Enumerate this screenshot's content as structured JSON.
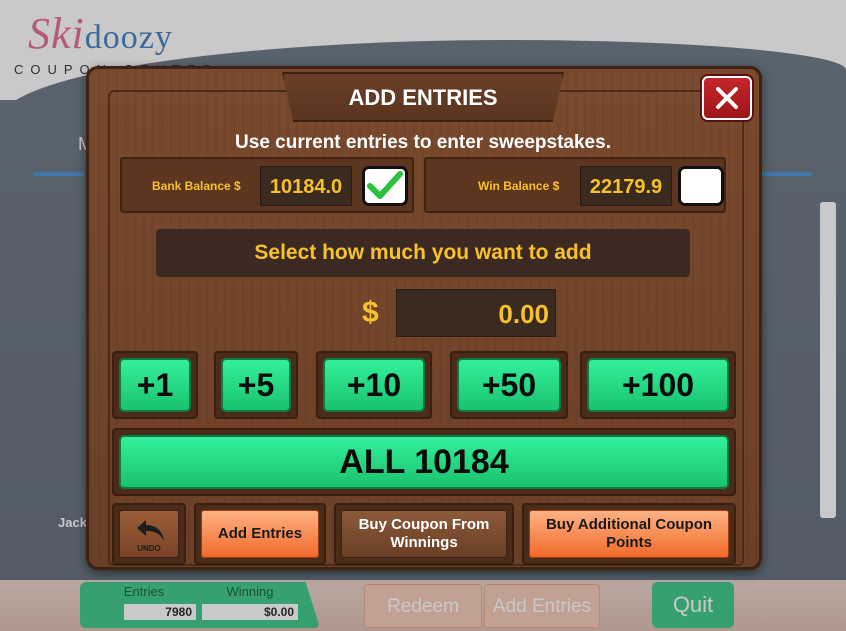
{
  "background": {
    "logo": {
      "brand_main": "Skidoozy",
      "brand_pink": "Ski",
      "brand_blue": "doozy",
      "tagline": "COUPON CENTER"
    },
    "partial_letter": "M",
    "partial_row_name": "Jack"
  },
  "bottom_bar": {
    "entries_label": "Entries",
    "entries_value": "7980",
    "winning_label": "Winning",
    "winning_value": "$0.00",
    "redeem_label": "Redeem",
    "add_entries_label": "Add Entries",
    "quit_label": "Quit"
  },
  "modal": {
    "title": "ADD ENTRIES",
    "subtitle": "Use current entries to enter sweepstakes.",
    "bank_label": "Bank Balance $",
    "bank_value": "10184.0",
    "bank_checked": true,
    "win_label": "Win Balance $",
    "win_value": "22179.9",
    "win_checked": false,
    "select_prompt": "Select how much you want to add",
    "currency_symbol": "$",
    "amount": "0.00",
    "increments": [
      "+1",
      "+5",
      "+10",
      "+50",
      "+100"
    ],
    "all_label": "ALL 10184",
    "undo_label": "UNDO",
    "add_entries_btn": "Add Entries",
    "buy_from_winnings_btn": "Buy Coupon From Winnings",
    "buy_additional_btn": "Buy Additional Coupon Points"
  },
  "colors": {
    "wood": "#6b3f27",
    "gold_text": "#f6c12a",
    "green_button": "#1ac26f",
    "orange_button": "#f26a2a",
    "close_red": "#c6262a"
  }
}
